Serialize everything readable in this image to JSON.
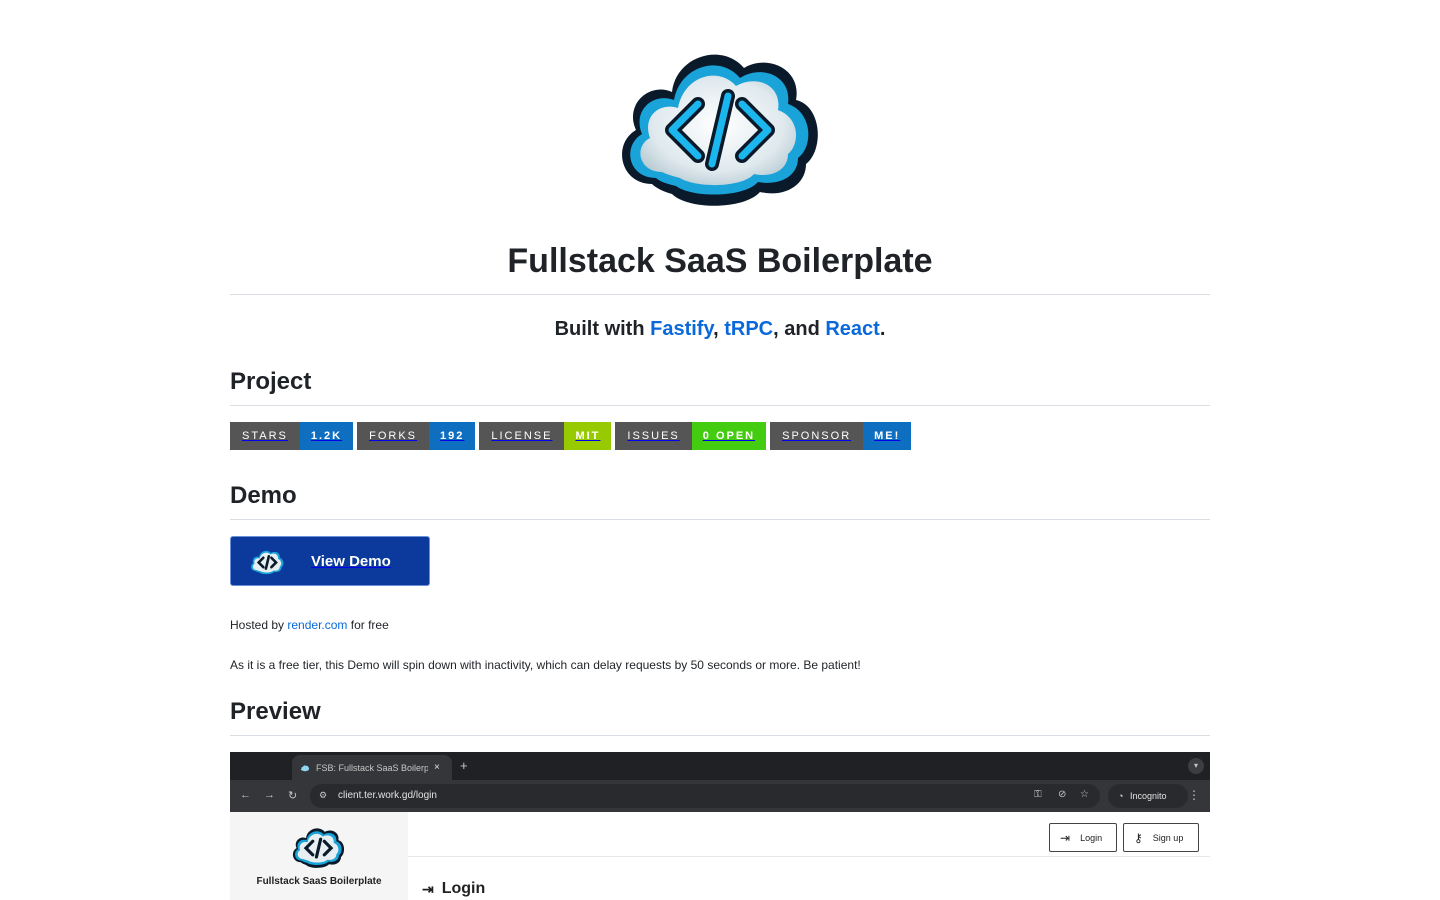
{
  "header": {
    "logo_icon": "cloud-code-icon",
    "title": "Fullstack SaaS Boilerplate"
  },
  "tagline": {
    "prefix": "Built with ",
    "link1": "Fastify",
    "sep1": ", ",
    "link2": "tRPC",
    "sep2": ", and ",
    "link3": "React",
    "suffix": "."
  },
  "sections": {
    "project": "Project",
    "demo": "Demo",
    "preview": "Preview"
  },
  "badges": [
    {
      "label": "STARS",
      "value": "1.2K",
      "color": "#0e6fc1"
    },
    {
      "label": "FORKS",
      "value": "192",
      "color": "#0e6fc1"
    },
    {
      "label": "LICENSE",
      "value": "MIT",
      "color": "#97ca00"
    },
    {
      "label": "ISSUES",
      "value": "0 OPEN",
      "color": "#4c1"
    },
    {
      "label": "SPONSOR",
      "value": "ME!",
      "color": "#0e6fc1"
    }
  ],
  "demo": {
    "button_label": "View Demo",
    "hosted_prefix": "Hosted by ",
    "hosted_link": "render.com",
    "hosted_suffix": " for free",
    "note": "As it is a free tier, this Demo will spin down with inactivity, which can delay requests by 50 seconds or more. Be patient!"
  },
  "preview": {
    "tab_title": "FSB: Fullstack SaaS Boilerplate",
    "tab_close": "×",
    "new_tab": "+",
    "url": "client.ter.work.gd/login",
    "incognito_label": "Incognito",
    "app_name": "Fullstack SaaS Boilerplate",
    "login_button": "Login",
    "signup_button": "Sign up",
    "page_heading": "Login"
  },
  "colors": {
    "link": "#0969da",
    "demo_button_bg": "#0b3a9c",
    "badge_label_bg": "#555555"
  }
}
